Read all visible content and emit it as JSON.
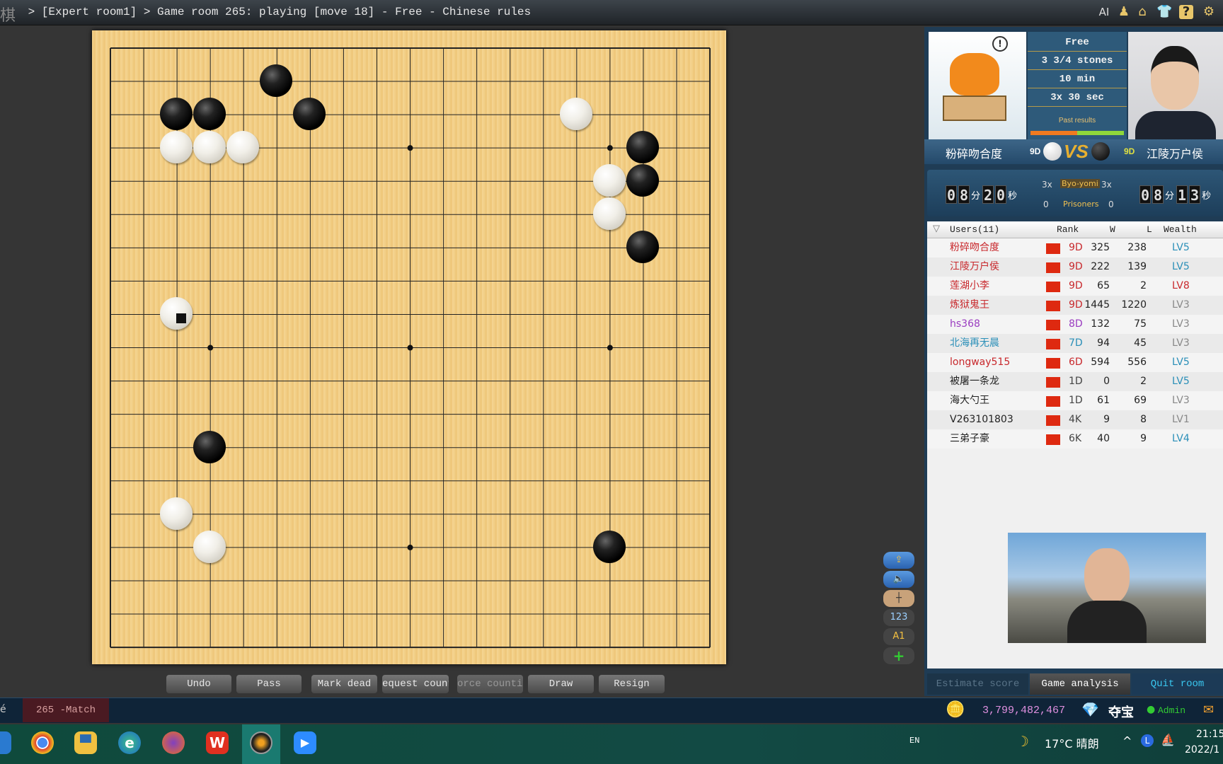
{
  "titlebar": {
    "logo": "棋",
    "text": " > [Expert room1] > Game room 265: playing [move 18] - Free - Chinese rules",
    "icons": [
      "ai-label",
      "user-icon",
      "home-icon",
      "shirt-icon",
      "help-icon",
      "gear-icon"
    ],
    "ai_label": "AI"
  },
  "board": {
    "size": 19,
    "star_points": [
      [
        3,
        3
      ],
      [
        3,
        9
      ],
      [
        3,
        15
      ],
      [
        9,
        3
      ],
      [
        9,
        9
      ],
      [
        9,
        15
      ],
      [
        15,
        3
      ],
      [
        15,
        9
      ],
      [
        15,
        15
      ]
    ],
    "black": [
      [
        5,
        1
      ],
      [
        2,
        2
      ],
      [
        3,
        2
      ],
      [
        6,
        2
      ],
      [
        16,
        3
      ],
      [
        16,
        4
      ],
      [
        16,
        6
      ],
      [
        3,
        12
      ],
      [
        15,
        15
      ]
    ],
    "white": [
      [
        2,
        3
      ],
      [
        3,
        3
      ],
      [
        4,
        3
      ],
      [
        14,
        2
      ],
      [
        15,
        4
      ],
      [
        15,
        5
      ],
      [
        2,
        8
      ],
      [
        2,
        14
      ],
      [
        3,
        15
      ]
    ],
    "last_move": [
      2,
      8
    ]
  },
  "controls": {
    "undo": "Undo",
    "pass": "Pass",
    "mark_dead": "Mark dead",
    "request_counting": "equest countir",
    "force_counting": "orce counting",
    "draw": "Draw",
    "resign": "Resign"
  },
  "side_tools": [
    "share-icon",
    "sound-icon",
    "board-icon",
    "123",
    "A1",
    "plus-icon"
  ],
  "match_info": {
    "mode": "Free",
    "komi": "3 3/4 stones",
    "main_time": "10 min",
    "byoyomi": "3x 30 sec",
    "past_results": "Past results",
    "past_results_ratio": 0.5
  },
  "players": {
    "white": {
      "name": "粉碎吻合度",
      "rank": "9D"
    },
    "black": {
      "name": "江陵万户侯",
      "rank": "9D"
    },
    "vs": "VS"
  },
  "timers": {
    "white": {
      "min": [
        "0",
        "8"
      ],
      "sec": [
        "2",
        "0"
      ],
      "byoyomi": "3x",
      "prisoners": "0"
    },
    "black": {
      "min": [
        "0",
        "8"
      ],
      "sec": [
        "1",
        "3"
      ],
      "byoyomi": "3x",
      "prisoners": "0"
    },
    "min_unit": "分",
    "sec_unit": "秒",
    "byoyomi_label": "Byo-yomi",
    "prisoners_label": "Prisoners"
  },
  "users": {
    "header": {
      "users": "Users(11)",
      "rank": "Rank",
      "w": "W",
      "l": "L",
      "wealth": "Wealth"
    },
    "rows": [
      {
        "name": "粉碎吻合度",
        "rank": "9D",
        "w": "325",
        "l": "238",
        "wealth": "LV5",
        "color": "#c8282c",
        "lvcolor": "#2a8fb8"
      },
      {
        "name": "江陵万户侯",
        "rank": "9D",
        "w": "222",
        "l": "139",
        "wealth": "LV5",
        "color": "#c8282c",
        "lvcolor": "#2a8fb8"
      },
      {
        "name": "莲湖小李",
        "rank": "9D",
        "w": "65",
        "l": "2",
        "wealth": "LV8",
        "color": "#c8282c",
        "lvcolor": "#c8282c"
      },
      {
        "name": "炼狱鬼王",
        "rank": "9D",
        "w": "1445",
        "l": "1220",
        "wealth": "LV3",
        "color": "#c8282c",
        "lvcolor": "#888"
      },
      {
        "name": "hs368",
        "rank": "8D",
        "w": "132",
        "l": "75",
        "wealth": "LV3",
        "color": "#9a3cc0",
        "lvcolor": "#888"
      },
      {
        "name": "北海再无晨",
        "rank": "7D",
        "w": "94",
        "l": "45",
        "wealth": "LV3",
        "color": "#2a8fb8",
        "lvcolor": "#888"
      },
      {
        "name": "longway515",
        "rank": "6D",
        "w": "594",
        "l": "556",
        "wealth": "LV5",
        "color": "#c8282c",
        "lvcolor": "#2a8fb8"
      },
      {
        "name": "被屠一条龙",
        "rank": "1D",
        "w": "0",
        "l": "2",
        "wealth": "LV5",
        "color": "#222",
        "lvcolor": "#2a8fb8"
      },
      {
        "name": "海大勺王",
        "rank": "1D",
        "w": "61",
        "l": "69",
        "wealth": "LV3",
        "color": "#222",
        "lvcolor": "#888"
      },
      {
        "name": "V263101803",
        "rank": "4K",
        "w": "9",
        "l": "8",
        "wealth": "LV1",
        "color": "#222",
        "lvcolor": "#888"
      },
      {
        "name": "三弟子豪",
        "rank": "6K",
        "w": "40",
        "l": "9",
        "wealth": "LV4",
        "color": "#222",
        "lvcolor": "#2a8fb8"
      }
    ]
  },
  "panel_tabs": {
    "estimate": "Estimate score",
    "analysis": "Game analysis",
    "quit": "Quit room"
  },
  "statusbar": {
    "left_tab": "é",
    "match_tab": "265 -Match",
    "coins": "3,799,482,467",
    "treasure": "夺宝",
    "admin": "Admin"
  },
  "taskbar": {
    "lang": "EN",
    "weather": "17°C 晴朗",
    "time": "21:15",
    "date": "2022/1"
  }
}
